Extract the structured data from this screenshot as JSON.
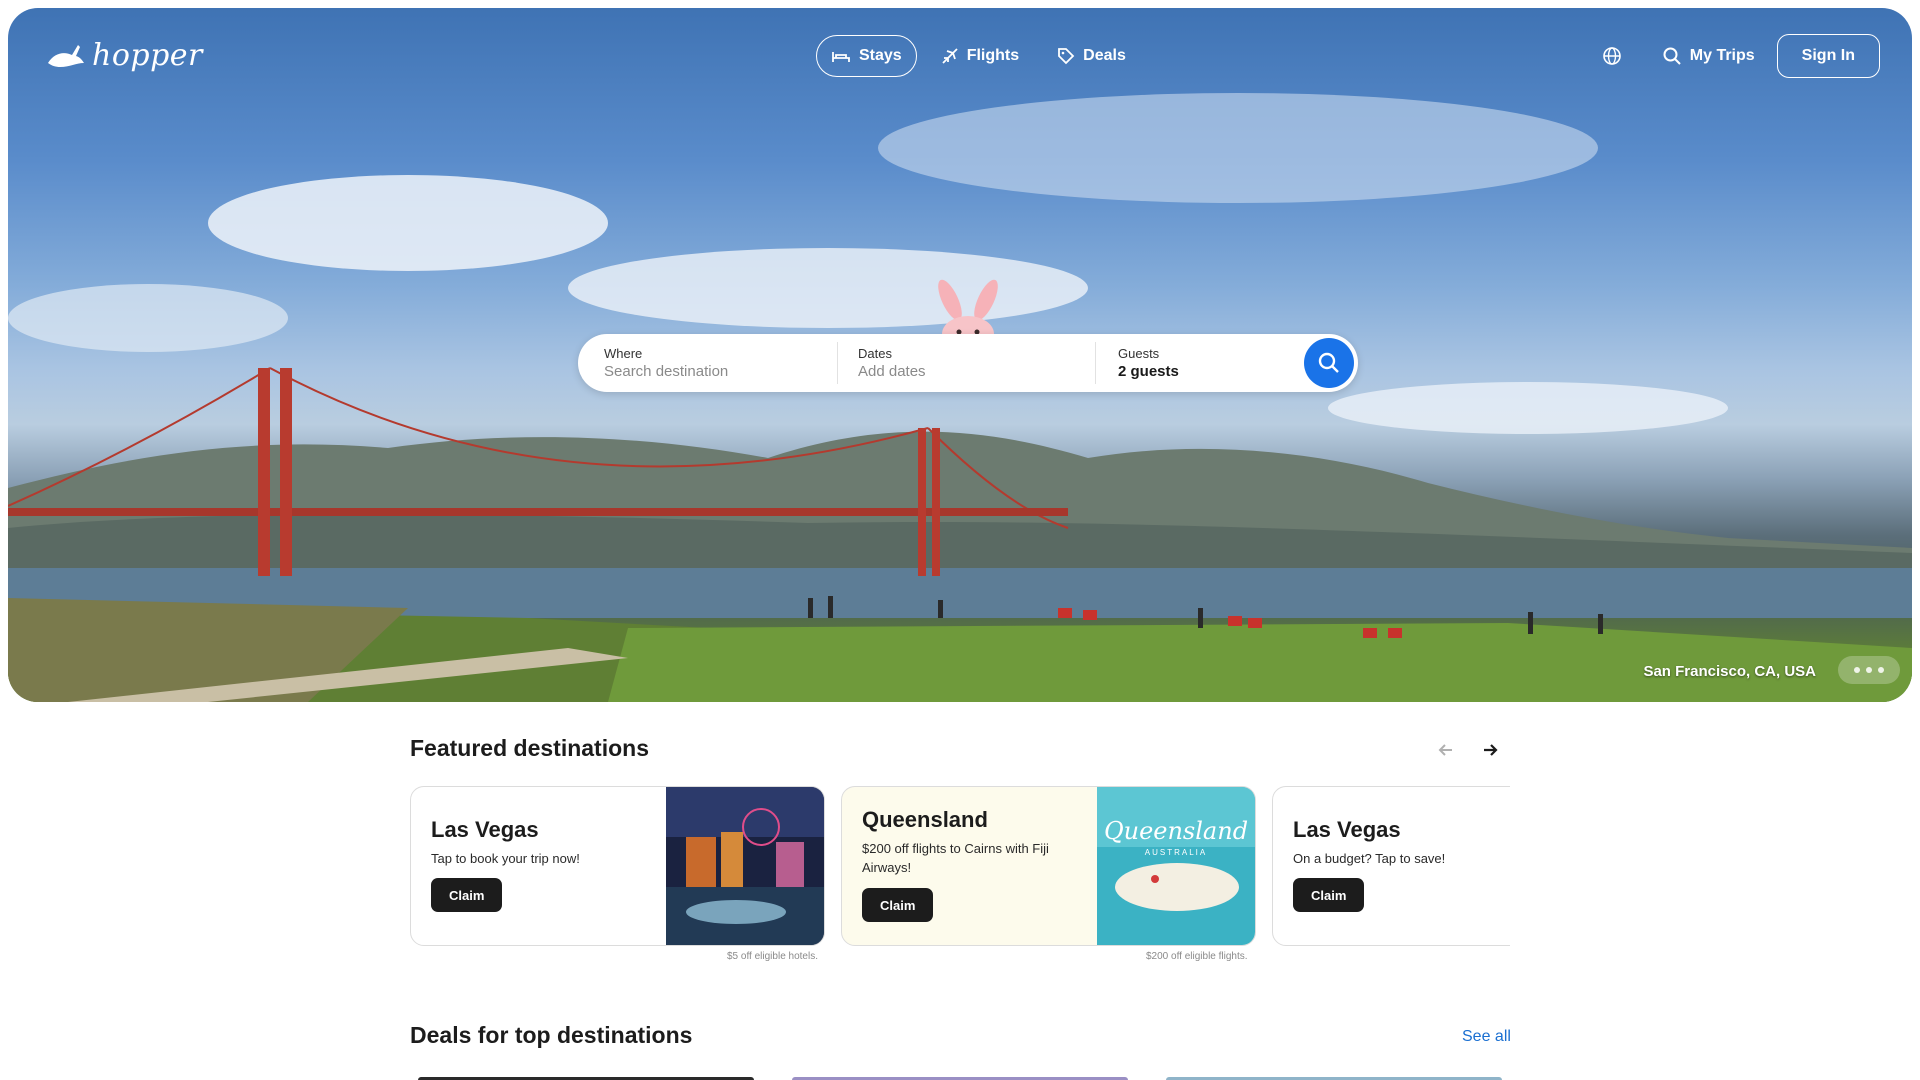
{
  "brand": {
    "name": "hopper"
  },
  "nav": {
    "tabs": [
      {
        "label": "Stays",
        "icon": "bed-icon",
        "active": true
      },
      {
        "label": "Flights",
        "icon": "plane-icon",
        "active": false
      },
      {
        "label": "Deals",
        "icon": "tag-icon",
        "active": false
      }
    ],
    "my_trips": "My Trips",
    "sign_in": "Sign In"
  },
  "search": {
    "where_label": "Where",
    "where_placeholder": "Search destination",
    "dates_label": "Dates",
    "dates_placeholder": "Add dates",
    "guests_label": "Guests",
    "guests_value": "2 guests"
  },
  "hero": {
    "location": "San Francisco, CA, USA"
  },
  "featured": {
    "title": "Featured destinations",
    "cards": [
      {
        "title": "Las Vegas",
        "subtitle": "Tap to book your trip now!",
        "cta": "Claim",
        "fineprint": "$5 off eligible hotels."
      },
      {
        "title": "Queensland",
        "subtitle": "$200 off flights to Cairns with Fiji Airways!",
        "cta": "Claim",
        "fineprint": "$200 off eligible flights.",
        "image_text": "Queensland",
        "image_subtext": "AUSTRALIA"
      },
      {
        "title": "Las Vegas",
        "subtitle": "On a budget? Tap to save!",
        "cta": "Claim"
      }
    ]
  },
  "deals": {
    "title": "Deals for top destinations",
    "see_all": "See all"
  },
  "colors": {
    "accent": "#1a73e8",
    "link": "#1a6fd1",
    "dark": "#1c1c1c"
  }
}
